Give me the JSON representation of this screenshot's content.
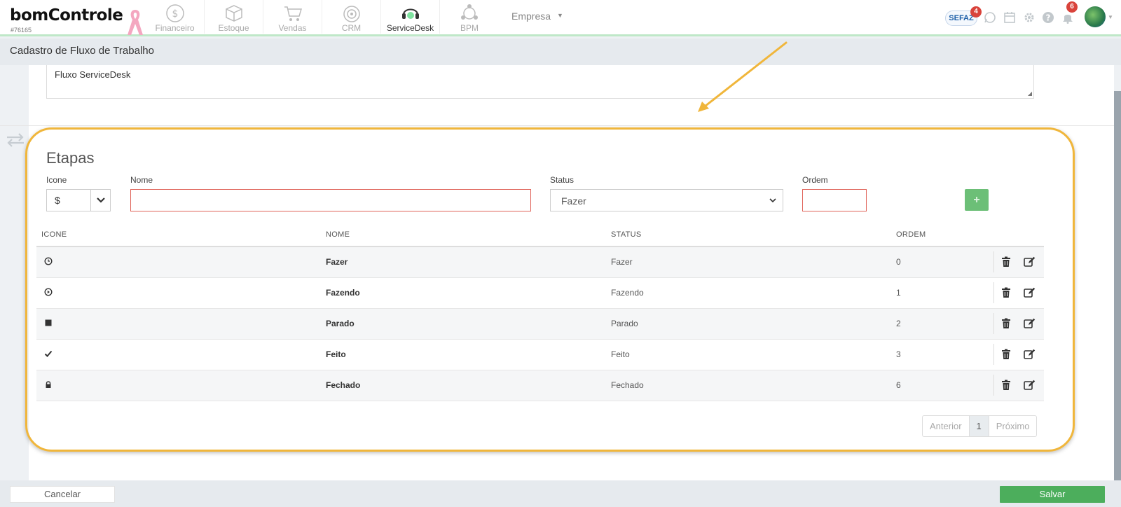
{
  "brand": {
    "name": "bomControle",
    "account_id": "#76165"
  },
  "nav": [
    {
      "label": "Financeiro",
      "icon": "dollar-coin-icon",
      "active": false
    },
    {
      "label": "Estoque",
      "icon": "box-icon",
      "active": false
    },
    {
      "label": "Vendas",
      "icon": "cart-icon",
      "active": false
    },
    {
      "label": "CRM",
      "icon": "target-icon",
      "active": false
    },
    {
      "label": "ServiceDesk",
      "icon": "headset-icon",
      "active": true
    },
    {
      "label": "BPM",
      "icon": "network-icon",
      "active": false
    }
  ],
  "empresa": {
    "label": "Empresa"
  },
  "header_right": {
    "sefaz_label": "SEFAZ",
    "sefaz_badge": "4",
    "notifications_badge": "6"
  },
  "page": {
    "title": "Cadastro de Fluxo de Trabalho"
  },
  "description": {
    "value": "Fluxo ServiceDesk"
  },
  "etapas": {
    "title": "Etapas",
    "form": {
      "icone_label": "Icone",
      "icone_value": "$",
      "nome_label": "Nome",
      "nome_value": "",
      "status_label": "Status",
      "status_value": "Fazer",
      "ordem_label": "Ordem",
      "ordem_value": "",
      "add_label": "+"
    },
    "table": {
      "columns": [
        "ICONE",
        "NOME",
        "STATUS",
        "ORDEM"
      ],
      "rows": [
        {
          "icon": "clock-icon",
          "nome": "Fazer",
          "status": "Fazer",
          "ordem": "0"
        },
        {
          "icon": "play-circle-icon",
          "nome": "Fazendo",
          "status": "Fazendo",
          "ordem": "1"
        },
        {
          "icon": "stop-icon",
          "nome": "Parado",
          "status": "Parado",
          "ordem": "2"
        },
        {
          "icon": "check-icon",
          "nome": "Feito",
          "status": "Feito",
          "ordem": "3"
        },
        {
          "icon": "lock-icon",
          "nome": "Fechado",
          "status": "Fechado",
          "ordem": "6"
        }
      ]
    },
    "pagination": {
      "prev": "Anterior",
      "current": "1",
      "next": "Próximo"
    }
  },
  "footer": {
    "cancel_label": "Cancelar",
    "save_label": "Salvar"
  },
  "colors": {
    "accent_green": "#4cae5c",
    "highlight": "#f0b63b",
    "error_border": "#e0645a"
  }
}
